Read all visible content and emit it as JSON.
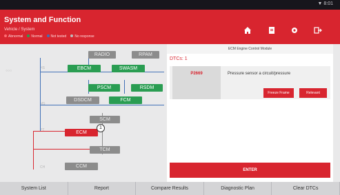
{
  "status": {
    "right_text": "▼ 8:01"
  },
  "header": {
    "title": "System and Function",
    "subtitle": "Vehicle / System",
    "legend": [
      {
        "label": "Abnormal",
        "color": "#d8252f"
      },
      {
        "label": "Normal",
        "color": "#2a9d52"
      },
      {
        "label": "Not tested",
        "color": "#3f6fb6"
      },
      {
        "label": "No response",
        "color": "#8c8c8c"
      }
    ],
    "icons": [
      "home-icon",
      "report-icon",
      "settings-icon",
      "exit-icon"
    ]
  },
  "topology": {
    "modules": {
      "radio": "RADIO",
      "rpam": "RPAM",
      "ebcm": "EBCM",
      "swasm": "SWASM",
      "pscm": "PSCM",
      "rsdm": "RSDM",
      "dsdcm": "DSDCM",
      "fcm": "FCM",
      "scm": "SCM",
      "ecm": "ECM",
      "tcm": "TCM",
      "ccm": "CCM"
    },
    "ecm_badge": "1"
  },
  "panel": {
    "header": "ECM Engine Control Module",
    "dtc_title": "DTCs: 1",
    "dtc_code": "P2669",
    "dtc_description": "Pressure sensor a circuit/pressure",
    "freeze_button": "Freeze Frame",
    "read_button": "Relevant",
    "enter_button": "ENTER"
  },
  "bottom_tabs": [
    "System List",
    "Report",
    "Compare Results",
    "Diagnostic Plan",
    "Clear DTCs"
  ]
}
